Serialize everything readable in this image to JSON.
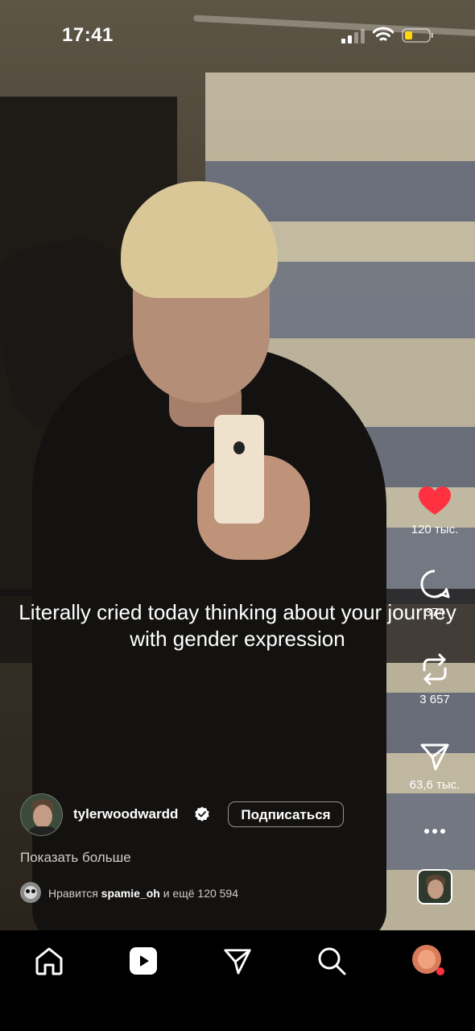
{
  "status_bar": {
    "time": "17:41"
  },
  "caption": {
    "text": "Literally cried today thinking about your journey with gender expression"
  },
  "actions": {
    "likes_count": "120 тыс.",
    "comments_count": "374",
    "reposts_count": "3 657",
    "shares_count": "63,6 тыс."
  },
  "author": {
    "username": "tylerwoodwardd",
    "follow_label": "Подписаться"
  },
  "description": {
    "show_more_label": "Показать больше"
  },
  "likes_line": {
    "prefix": "Нравится",
    "user": "spamie_oh",
    "middle": "и",
    "suffix": "ещё 120 594"
  },
  "icons": {
    "like": "heart-filled-icon",
    "comment": "comment-bubble-icon",
    "repost": "repost-arrows-icon",
    "share": "paper-plane-icon",
    "more": "ellipsis-icon",
    "verified": "verified-badge-icon",
    "nav_home": "home-icon",
    "nav_reels": "reels-play-icon",
    "nav_direct": "paper-plane-icon",
    "nav_search": "search-icon"
  },
  "colors": {
    "like_red": "#ff3040",
    "notification_dot": "#ff3040",
    "nav_background": "#000000"
  }
}
